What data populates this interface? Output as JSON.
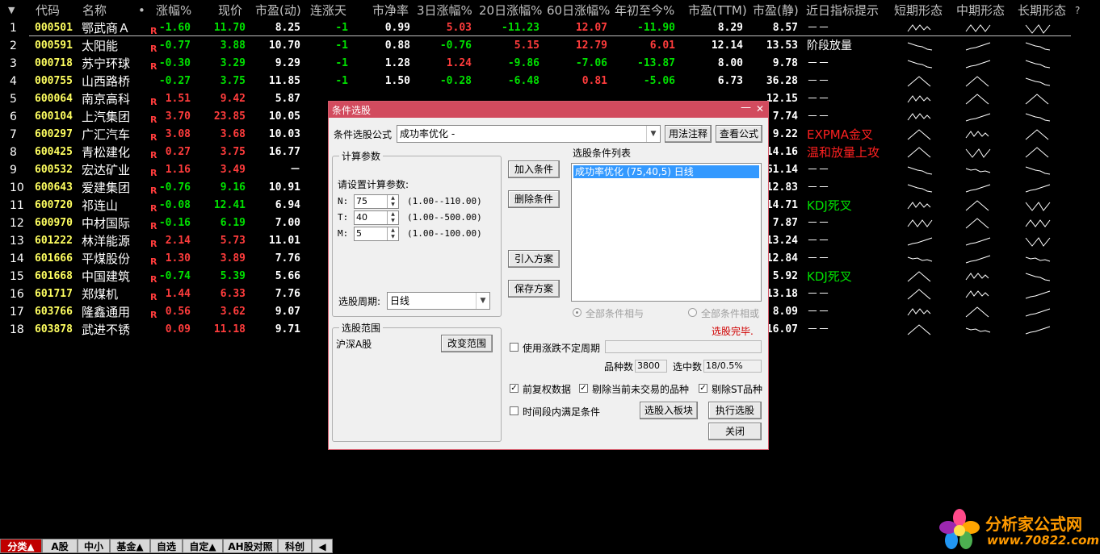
{
  "headers": {
    "sort": "▼",
    "code": "代码",
    "name": "名称",
    "dot": "•",
    "chg": "涨幅%",
    "price": "现价",
    "pe_dyn": "市盈(动)",
    "streak": "连涨天",
    "pb": "市净率",
    "d3": "3日涨幅%",
    "d20": "20日涨幅%",
    "d60": "60日涨幅%",
    "ytd": "年初至今%",
    "pe_ttm": "市盈(TTM)",
    "pe_static": "市盈(静)",
    "hint": "近日指标提示",
    "short": "短期形态",
    "mid": "中期形态",
    "long": "长期形态",
    "q": "?"
  },
  "rows": [
    {
      "idx": "1",
      "code": "000501",
      "name": "鄂武商Ａ",
      "r": "R",
      "chg": "-1.60",
      "price": "11.70",
      "pe": "8.25",
      "streak": "-1",
      "pb": "0.99",
      "d3": "5.03",
      "d20": "-11.23",
      "d60": "12.07",
      "ytd": "-11.90",
      "ttm": "8.29",
      "static": "8.57",
      "hint": "－－",
      "hintc": "plain"
    },
    {
      "idx": "2",
      "code": "000591",
      "name": "太阳能",
      "r": "R",
      "chg": "-0.77",
      "price": "3.88",
      "pe": "10.70",
      "streak": "-1",
      "pb": "0.88",
      "d3": "-0.76",
      "d20": "5.15",
      "d60": "12.79",
      "ytd": "6.01",
      "ttm": "12.14",
      "static": "13.53",
      "hint": "阶段放量",
      "hintc": "plain"
    },
    {
      "idx": "3",
      "code": "000718",
      "name": "苏宁环球",
      "r": "R",
      "chg": "-0.30",
      "price": "3.29",
      "pe": "9.29",
      "streak": "-1",
      "pb": "1.28",
      "d3": "1.24",
      "d20": "-9.86",
      "d60": "-7.06",
      "ytd": "-13.87",
      "ttm": "8.00",
      "static": "9.78",
      "hint": "－－",
      "hintc": "plain"
    },
    {
      "idx": "4",
      "code": "000755",
      "name": "山西路桥",
      "r": "",
      "chg": "-0.27",
      "price": "3.75",
      "pe": "11.85",
      "streak": "-1",
      "pb": "1.50",
      "d3": "-0.28",
      "d20": "-6.48",
      "d60": "0.81",
      "ytd": "-5.06",
      "ttm": "6.73",
      "static": "36.28",
      "hint": "－－",
      "hintc": "plain"
    },
    {
      "idx": "5",
      "code": "600064",
      "name": "南京高科",
      "r": "R",
      "chg": "1.51",
      "price": "9.42",
      "pe": "5.87",
      "streak": "",
      "pb": "",
      "d3": "",
      "d20": "",
      "d60": "",
      "ytd": "",
      "ttm": "",
      "static": "12.15",
      "hint": "－－",
      "hintc": "plain"
    },
    {
      "idx": "6",
      "code": "600104",
      "name": "上汽集团",
      "r": "R",
      "chg": "3.70",
      "price": "23.85",
      "pe": "10.05",
      "streak": "",
      "pb": "",
      "d3": "",
      "d20": "",
      "d60": "",
      "ytd": "",
      "ttm": "",
      "static": "7.74",
      "hint": "－－",
      "hintc": "plain"
    },
    {
      "idx": "7",
      "code": "600297",
      "name": "广汇汽车",
      "r": "R",
      "chg": "3.08",
      "price": "3.68",
      "pe": "10.03",
      "streak": "",
      "pb": "",
      "d3": "",
      "d20": "",
      "d60": "",
      "ytd": "",
      "ttm": "",
      "static": "9.22",
      "hint": "EXPMA金叉",
      "hintc": "red"
    },
    {
      "idx": "8",
      "code": "600425",
      "name": "青松建化",
      "r": "R",
      "chg": "0.27",
      "price": "3.75",
      "pe": "16.77",
      "streak": "",
      "pb": "",
      "d3": "",
      "d20": "",
      "d60": "",
      "ytd": "",
      "ttm": "",
      "static": "14.16",
      "hint": "温和放量上攻",
      "hintc": "red"
    },
    {
      "idx": "9",
      "code": "600532",
      "name": "宏达矿业",
      "r": "R",
      "chg": "1.16",
      "price": "3.49",
      "pe": "－",
      "streak": "",
      "pb": "",
      "d3": "",
      "d20": "",
      "d60": "",
      "ytd": "",
      "ttm": "",
      "static": "61.14",
      "hint": "－－",
      "hintc": "plain"
    },
    {
      "idx": "10",
      "code": "600643",
      "name": "爱建集团",
      "r": "R",
      "chg": "-0.76",
      "price": "9.16",
      "pe": "10.91",
      "streak": "",
      "pb": "",
      "d3": "",
      "d20": "",
      "d60": "",
      "ytd": "",
      "ttm": "",
      "static": "12.83",
      "hint": "－－",
      "hintc": "plain"
    },
    {
      "idx": "11",
      "code": "600720",
      "name": "祁连山",
      "r": "R",
      "chg": "-0.08",
      "price": "12.41",
      "pe": "6.94",
      "streak": "",
      "pb": "",
      "d3": "",
      "d20": "",
      "d60": "",
      "ytd": "",
      "ttm": "",
      "static": "14.71",
      "hint": "KDJ死叉",
      "hintc": "green"
    },
    {
      "idx": "12",
      "code": "600970",
      "name": "中材国际",
      "r": "R",
      "chg": "-0.16",
      "price": "6.19",
      "pe": "7.00",
      "streak": "",
      "pb": "",
      "d3": "",
      "d20": "",
      "d60": "",
      "ytd": "",
      "ttm": "",
      "static": "7.87",
      "hint": "－－",
      "hintc": "plain"
    },
    {
      "idx": "13",
      "code": "601222",
      "name": "林洋能源",
      "r": "R",
      "chg": "2.14",
      "price": "5.73",
      "pe": "11.01",
      "streak": "",
      "pb": "",
      "d3": "",
      "d20": "",
      "d60": "",
      "ytd": "",
      "ttm": "",
      "static": "13.24",
      "hint": "－－",
      "hintc": "plain"
    },
    {
      "idx": "14",
      "code": "601666",
      "name": "平煤股份",
      "r": "R",
      "chg": "1.30",
      "price": "3.89",
      "pe": "7.76",
      "streak": "",
      "pb": "",
      "d3": "",
      "d20": "",
      "d60": "",
      "ytd": "",
      "ttm": "",
      "static": "12.84",
      "hint": "－－",
      "hintc": "plain"
    },
    {
      "idx": "15",
      "code": "601668",
      "name": "中国建筑",
      "r": "R",
      "chg": "-0.74",
      "price": "5.39",
      "pe": "5.66",
      "streak": "",
      "pb": "",
      "d3": "",
      "d20": "",
      "d60": "",
      "ytd": "",
      "ttm": "",
      "static": "5.92",
      "hint": "KDJ死叉",
      "hintc": "green"
    },
    {
      "idx": "16",
      "code": "601717",
      "name": "郑煤机",
      "r": "R",
      "chg": "1.44",
      "price": "6.33",
      "pe": "7.76",
      "streak": "",
      "pb": "",
      "d3": "",
      "d20": "",
      "d60": "",
      "ytd": "",
      "ttm": "",
      "static": "13.18",
      "hint": "－－",
      "hintc": "plain"
    },
    {
      "idx": "17",
      "code": "603766",
      "name": "隆鑫通用",
      "r": "R",
      "chg": "0.56",
      "price": "3.62",
      "pe": "9.07",
      "streak": "",
      "pb": "",
      "d3": "",
      "d20": "",
      "d60": "",
      "ytd": "",
      "ttm": "",
      "static": "8.09",
      "hint": "－－",
      "hintc": "plain"
    },
    {
      "idx": "18",
      "code": "603878",
      "name": "武进不锈",
      "r": "",
      "chg": "0.09",
      "price": "11.18",
      "pe": "9.71",
      "streak": "",
      "pb": "",
      "d3": "",
      "d20": "",
      "d60": "",
      "ytd": "",
      "ttm": "",
      "static": "16.07",
      "hint": "－－",
      "hintc": "plain"
    }
  ],
  "dialog": {
    "title": "条件选股",
    "min": "—",
    "close": "✕",
    "formula_label": "条件选股公式",
    "formula_value": "成功率优化    -",
    "btn_usage": "用法注释",
    "btn_view": "查看公式",
    "params_group": "计算参数",
    "params_prompt": "请设置计算参数:",
    "params": [
      {
        "label": "N:",
        "value": "75",
        "range": "(1.00--110.00)"
      },
      {
        "label": "T:",
        "value": "40",
        "range": "(1.00--500.00)"
      },
      {
        "label": "M:",
        "value": "5",
        "range": "(1.00--100.00)"
      }
    ],
    "period_label": "选股周期:",
    "period_value": "日线",
    "btn_add": "加入条件",
    "btn_delete": "删除条件",
    "btn_import": "引入方案",
    "btn_save": "保存方案",
    "list_label": "选股条件列表",
    "list_item": "成功率优化 (75,40,5) 日线",
    "radio_and": "全部条件相与",
    "radio_or": "全部条件相或",
    "status": "选股完毕.",
    "range_group": "选股范围",
    "range_value": "沪深A股",
    "btn_change_range": "改变范围",
    "chk_uncertain": "使用涨跌不定周期",
    "count_label": "品种数",
    "count_value": "3800",
    "selected_label": "选中数",
    "selected_value": "18/0.5%",
    "chk_fq": "前复权数据",
    "chk_exclude_untraded": "剔除当前未交易的品种",
    "chk_exclude_st": "剔除ST品种",
    "chk_period": "时间段内满足条件",
    "btn_to_block": "选股入板块",
    "btn_execute": "执行选股",
    "btn_close": "关闭"
  },
  "tabs": [
    "分类▲",
    "A股",
    "中小",
    "基金▲",
    "自选",
    "自定▲",
    "AH股对照",
    "科创",
    "◀"
  ],
  "logo": {
    "line1": "分析家公式网",
    "line2": "www.70822.com"
  },
  "colors": {
    "up": "#ff3c3c",
    "down": "#00e000",
    "code": "#ffff60",
    "dialog_title": "#d24b5e",
    "selection": "#3399ff"
  }
}
